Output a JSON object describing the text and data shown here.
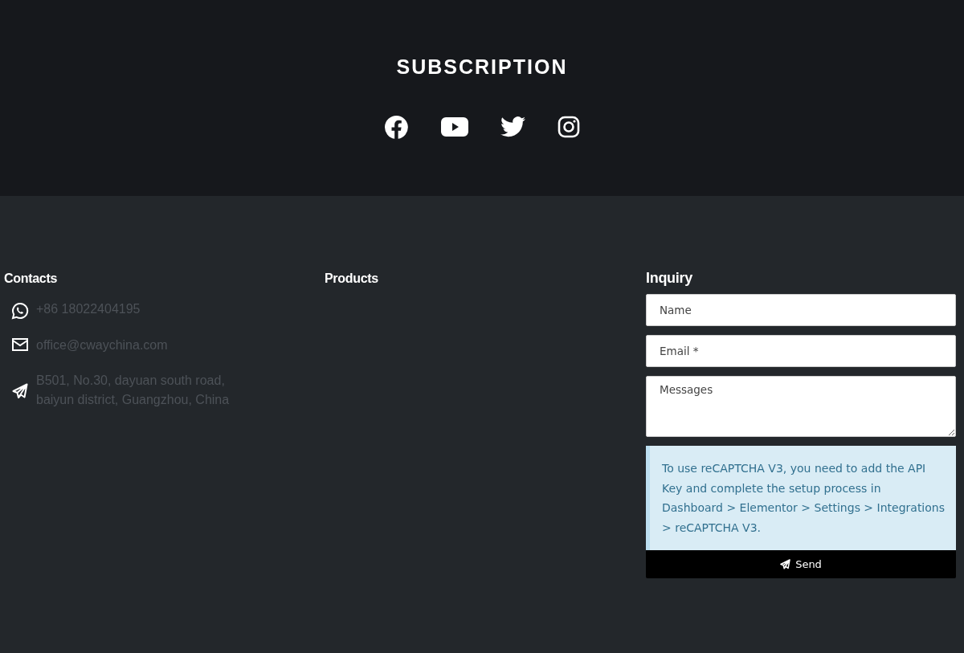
{
  "subscription": {
    "title": "SUBSCRIPTION",
    "social": [
      {
        "kind": "facebook"
      },
      {
        "kind": "youtube"
      },
      {
        "kind": "twitter"
      },
      {
        "kind": "instagram"
      }
    ]
  },
  "contacts": {
    "heading": "Contacts",
    "items": [
      {
        "kind": "whatsapp",
        "lines": [
          "+86 18022404195"
        ]
      },
      {
        "kind": "email",
        "lines": [
          "office@cwaychina.com"
        ]
      },
      {
        "kind": "address",
        "lines": [
          "B501, No.30, dayuan south road,",
          "baiyun district, Guangzhou, China"
        ]
      }
    ]
  },
  "products": {
    "heading": "Products"
  },
  "inquiry": {
    "heading": "Inquiry",
    "fields": [
      {
        "kind": "input",
        "placeholder": "Name"
      },
      {
        "kind": "input",
        "placeholder": "Email *"
      },
      {
        "kind": "textarea",
        "placeholder": "Messages"
      }
    ],
    "notice": "To use reCAPTCHA V3, you need to add the API Key and complete the setup process in Dashboard > Elementor > Settings > Integrations > reCAPTCHA V3.",
    "button": "Send"
  }
}
